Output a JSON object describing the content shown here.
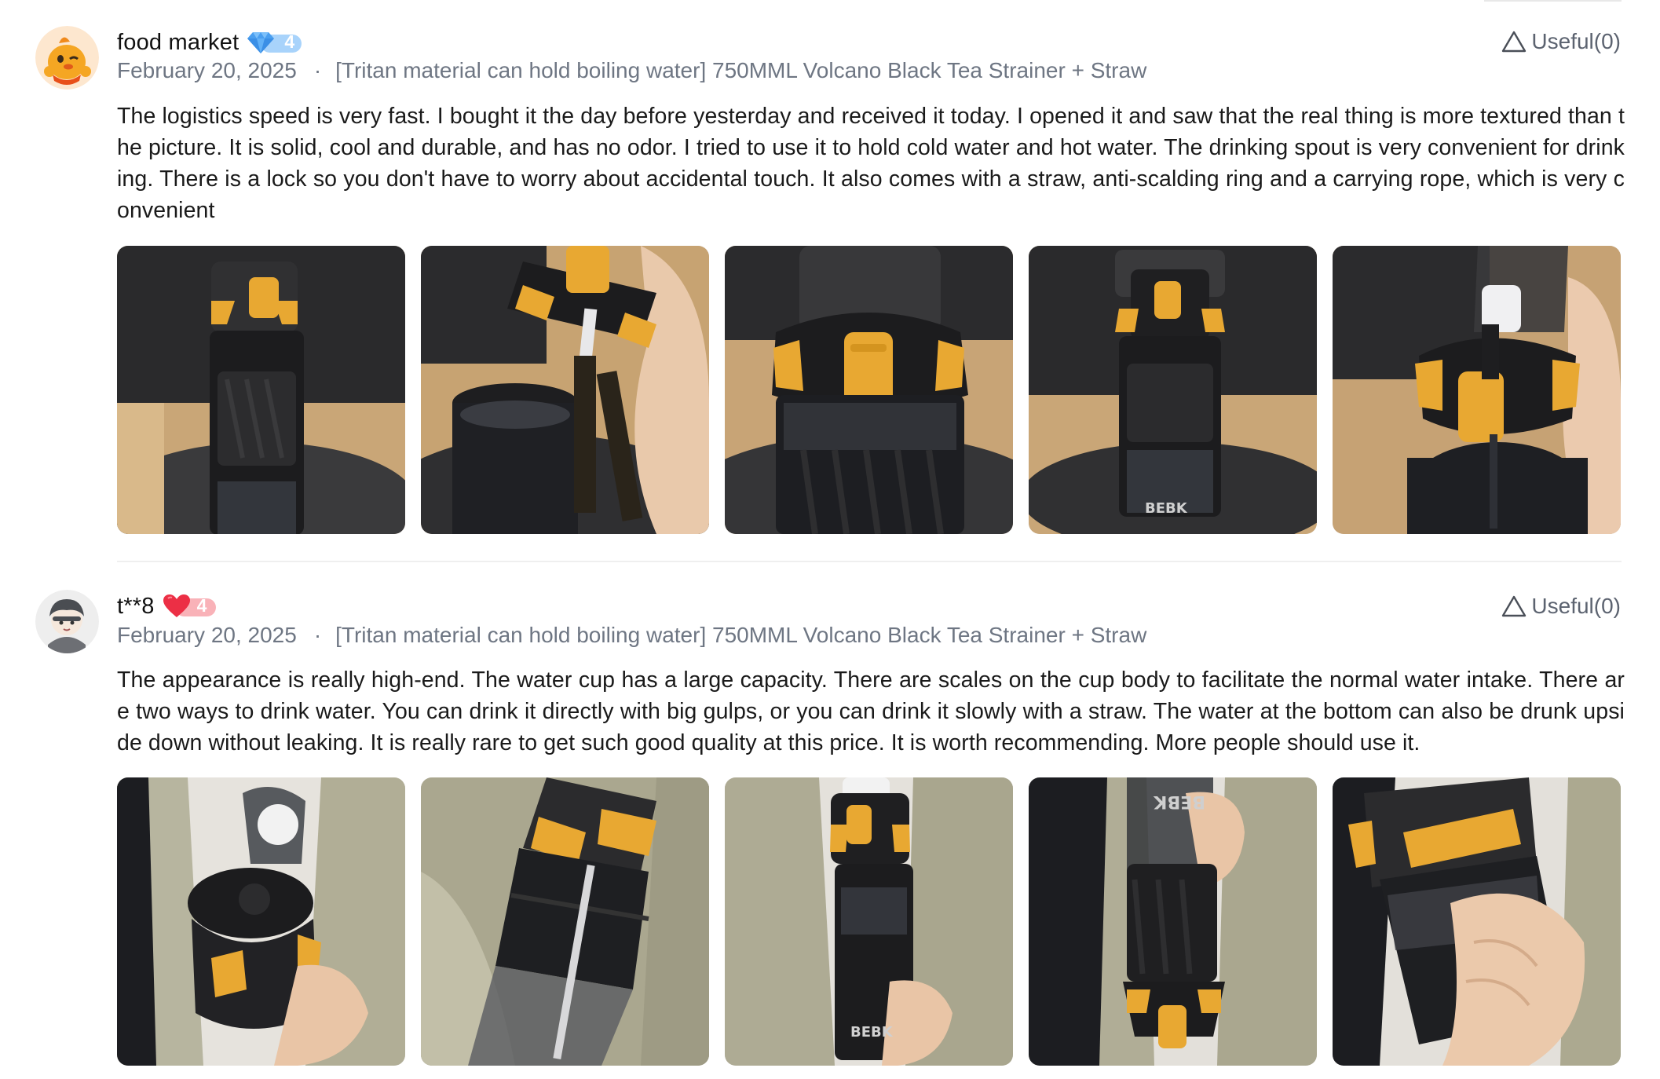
{
  "reviews": [
    {
      "username": "food market",
      "level": "4",
      "badge_icon": "diamond-icon",
      "badge_color": "#5aa8f0",
      "date": "February 20, 2025",
      "separator": "·",
      "variant": "[Tritan material can hold boiling water] 750MML Volcano Black Tea Strainer + Straw",
      "useful_label": "Useful(0)",
      "text": "The logistics speed is very fast. I bought it the day before yesterday and received it today. I opened it and saw that the real thing is more textured than the picture. It is solid, cool and durable, and has no odor. I tried to use it to hold cold water and hot water. The drinking spout is very convenient for drinking. There is a lock so you don't have to worry about accidental touch. It also comes with a straw, anti-scalding ring and a carrying rope, which is very convenient",
      "photos": [
        {
          "alt": "Bottle on chair, front view"
        },
        {
          "alt": "Open bottle with straw lid"
        },
        {
          "alt": "Close-up of lid lock"
        },
        {
          "alt": "Bottle on chair, full view"
        },
        {
          "alt": "Open flip lid with straw"
        }
      ]
    },
    {
      "username": "t**8",
      "level": "4",
      "badge_icon": "heart-icon",
      "badge_color": "#f04a5a",
      "date": "February 20, 2025",
      "separator": "·",
      "variant": "[Tritan material can hold boiling water] 750MML Volcano Black Tea Strainer + Straw",
      "useful_label": "Useful(0)",
      "text": "The appearance is really high-end. The water cup has a large capacity. There are scales on the cup body to facilitate the normal water intake. There are two ways to drink water. You can drink it directly with big gulps, or you can drink it slowly with a straw. The water at the bottom can also be drunk upside down without leaking. It is really rare to get such good quality at this price. It is worth recommending. More people should use it.",
      "photos": [
        {
          "alt": "Bottle held with lid open"
        },
        {
          "alt": "Bottle held at an angle"
        },
        {
          "alt": "Bottle held upright"
        },
        {
          "alt": "Bottle held upside down"
        },
        {
          "alt": "Bottle in hand, tilted"
        }
      ]
    }
  ],
  "colors": {
    "meta_text": "#6e7683",
    "accent_yellow": "#e8a832",
    "bottle_black": "#1c1c1e"
  }
}
